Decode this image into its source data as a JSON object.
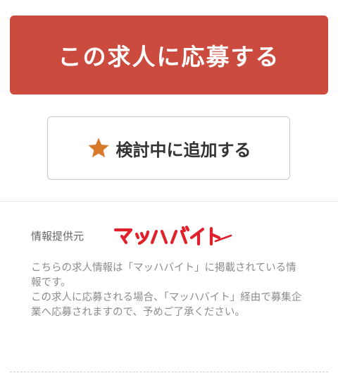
{
  "actions": {
    "apply_label": "この求人に応募する",
    "consider_label": "検討中に追加する",
    "star_icon": "star-icon",
    "apply_color": "#cc4b3f",
    "star_color": "#d9792a"
  },
  "source": {
    "label": "情報提供元",
    "logo_text": "マッハバイト",
    "logo_color": "#e0202a"
  },
  "notice": {
    "text": "こちらの求人情報は「マッハバイト」に掲載されている情報です。\nこの求人に応募される場合、「マッハバイト」経由で募集企業へ応募されますので、予めご了承ください。"
  }
}
